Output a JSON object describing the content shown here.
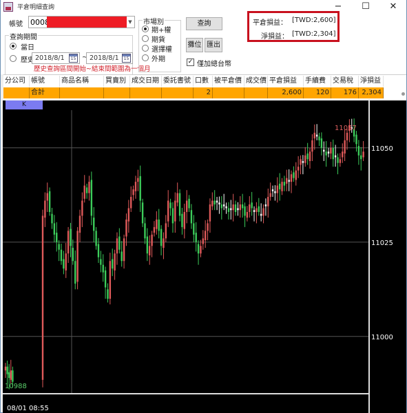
{
  "window": {
    "title": "平倉明細查詢",
    "minimize": "−",
    "maximize": "☐",
    "close": "✕"
  },
  "form": {
    "account_label": "帳號",
    "account_value": "0008",
    "period_group_title": "查詢期間",
    "period_today": "當日",
    "period_history": "歷史",
    "date_from": "2018/8/1",
    "date_to": "2018/8/1",
    "date_separator": "~",
    "calendar_icon_text": "15",
    "hint": "歷史查詢區間開始~結束間範圍為一個月",
    "market_group_title": "市場別",
    "market_options": [
      "期+權",
      "期貨",
      "選擇權",
      "外期"
    ],
    "market_selected": "期+權",
    "query_button": "查詢",
    "position_button": "攤位",
    "export_button": "匯出",
    "total_only_checkbox": "僅加總台幣",
    "total_only_checked": true
  },
  "summary": {
    "close_pnl_label": "平倉損益：",
    "close_pnl_value": "[TWD:2,600]",
    "net_pnl_label": "淨損益：",
    "net_pnl_value": "[TWD:2,304]"
  },
  "table": {
    "columns": [
      "分公司",
      "帳號",
      "商品名稱",
      "買賣別",
      "成交日期",
      "委託書號",
      "口數",
      "被平倉價",
      "成交價",
      "平倉損益",
      "手續費",
      "交易稅",
      "淨損益"
    ],
    "rows": [
      [
        "",
        "合計",
        "",
        "",
        "",
        "",
        "2",
        "",
        "",
        "2,600",
        "120",
        "176",
        "2,304"
      ]
    ]
  },
  "chart": {
    "tab_label": "K",
    "high_label": "11057",
    "low_label": "10988",
    "time_label": "08/01 08:55",
    "colors": {
      "up": "#e05a5a",
      "down": "#3ccc5a",
      "flat": "#ffffff",
      "grid": "#555555",
      "high_text": "#e06060",
      "low_text": "#5bd06b"
    }
  },
  "chart_data": {
    "type": "candlestick",
    "title": "",
    "y_ticks": [
      11000,
      11025,
      11050
    ],
    "ylim": [
      10985,
      11060
    ],
    "x_start_label": "08/01 08:55",
    "annotations": [
      {
        "text": "11057",
        "kind": "high"
      },
      {
        "text": "10988",
        "kind": "low"
      }
    ],
    "closes": [
      10992,
      10990,
      10989,
      10991,
      10988,
      11032,
      11036,
      11038,
      11033,
      11030,
      11027,
      11025,
      11023,
      11020,
      11018,
      11022,
      11028,
      11024,
      11020,
      11014,
      11028,
      11032,
      11036,
      11040,
      11038,
      11041,
      11032,
      11028,
      11024,
      11021,
      11019,
      11017,
      11013,
      11010,
      11020,
      11018,
      11022,
      11026,
      11023,
      11020,
      11026,
      11031,
      11034,
      11037,
      11039,
      11041,
      11042,
      11036,
      11030,
      11026,
      11022,
      11024,
      11027,
      11029,
      11031,
      11028,
      11024,
      11026,
      11030,
      11036,
      11034,
      11030,
      11036,
      11038,
      11032,
      11029,
      11033,
      11036,
      11034,
      11030,
      11027,
      11025,
      11022,
      11024,
      11026,
      11028,
      11030,
      11035,
      11036,
      11035,
      11036,
      11035,
      11034,
      11035,
      11034,
      11033,
      11034,
      11035,
      11033,
      11034,
      11035,
      11034,
      11032,
      11033,
      11035,
      11034,
      11033,
      11034,
      11033,
      11032,
      11034,
      11035,
      11037,
      11038,
      11039,
      11038,
      11040,
      11039,
      11041,
      11040,
      11042,
      11041,
      11043,
      11042,
      11044,
      11045,
      11047,
      11046,
      11048,
      11047,
      11049,
      11052,
      11054,
      11053,
      11052,
      11050,
      11049,
      11048,
      11049,
      11050,
      11047,
      11048,
      11046,
      11047,
      11049,
      11052,
      11054,
      11056,
      11055,
      11053,
      11051,
      11048,
      11047,
      11049
    ]
  }
}
